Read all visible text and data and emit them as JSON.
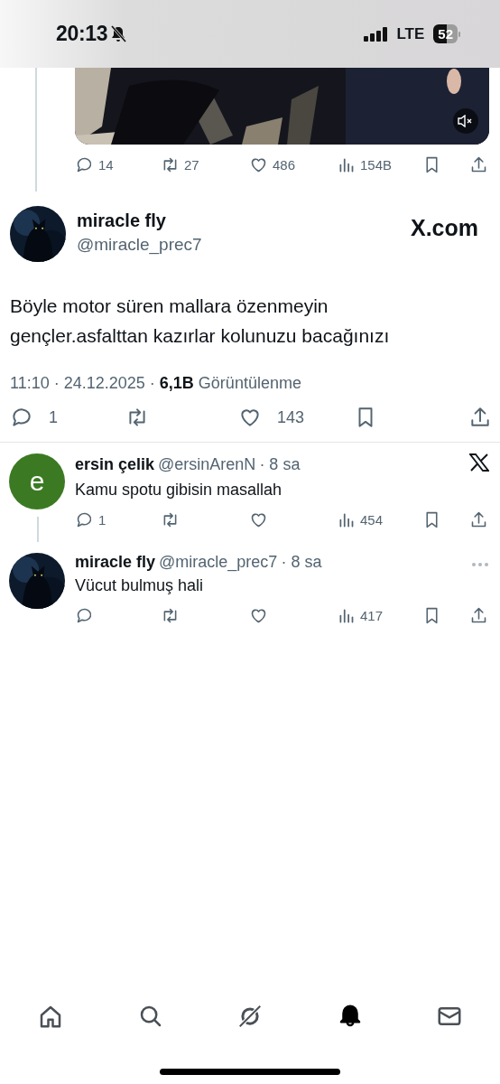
{
  "status_bar": {
    "time": "20:13",
    "silent": true,
    "network": "LTE",
    "battery": "52"
  },
  "parent_tweet": {
    "actions": [
      {
        "kind": "reply",
        "count": "14"
      },
      {
        "kind": "repost",
        "count": "27"
      },
      {
        "kind": "like",
        "count": "486"
      },
      {
        "kind": "views",
        "count": "154B"
      },
      {
        "kind": "bookmark"
      },
      {
        "kind": "share"
      }
    ]
  },
  "main_tweet": {
    "name": "miracle fly",
    "handle": "@miracle_prec7",
    "brand": "X.com",
    "text": "Böyle motor süren mallara özenmeyin gençler.asfalttan kazırlar kolunuzu bacağınızı",
    "timestamp": "11:10 · 24.12.2025 ·",
    "views_count": "6,1B",
    "views_label": "Görüntülenme",
    "actions": [
      {
        "kind": "reply",
        "count": "1"
      },
      {
        "kind": "repost"
      },
      {
        "kind": "like",
        "count": "143"
      },
      {
        "kind": "bookmark"
      },
      {
        "kind": "share"
      }
    ]
  },
  "replies": [
    {
      "avatar": {
        "kind": "letter",
        "letter": "e",
        "color": "#3b7a22"
      },
      "name": "ersin çelik",
      "handle": "@ersinArenN",
      "time": "· 8 sa",
      "corner_icon": {
        "kind": "x-logo"
      },
      "text": "Kamu spotu gibisin masallah",
      "thread_below": true,
      "actions": [
        {
          "kind": "reply",
          "count": "1"
        },
        {
          "kind": "repost"
        },
        {
          "kind": "like"
        },
        {
          "kind": "views",
          "count": "454"
        },
        {
          "kind": "bookmark"
        },
        {
          "kind": "share"
        }
      ]
    },
    {
      "name": "miracle fly",
      "handle": "@miracle_prec7",
      "time": "· 8 sa",
      "corner_icon": {
        "kind": "more"
      },
      "text": "Vücut bulmuş hali",
      "thread_below": false,
      "actions": [
        {
          "kind": "reply"
        },
        {
          "kind": "repost"
        },
        {
          "kind": "like"
        },
        {
          "kind": "views",
          "count": "417"
        },
        {
          "kind": "bookmark"
        },
        {
          "kind": "share"
        }
      ]
    }
  ],
  "bottom_nav": [
    {
      "kind": "home",
      "selected": false
    },
    {
      "kind": "search",
      "selected": false
    },
    {
      "kind": "grok",
      "selected": false
    },
    {
      "kind": "bell",
      "selected": true
    },
    {
      "kind": "mail",
      "selected": false
    }
  ]
}
